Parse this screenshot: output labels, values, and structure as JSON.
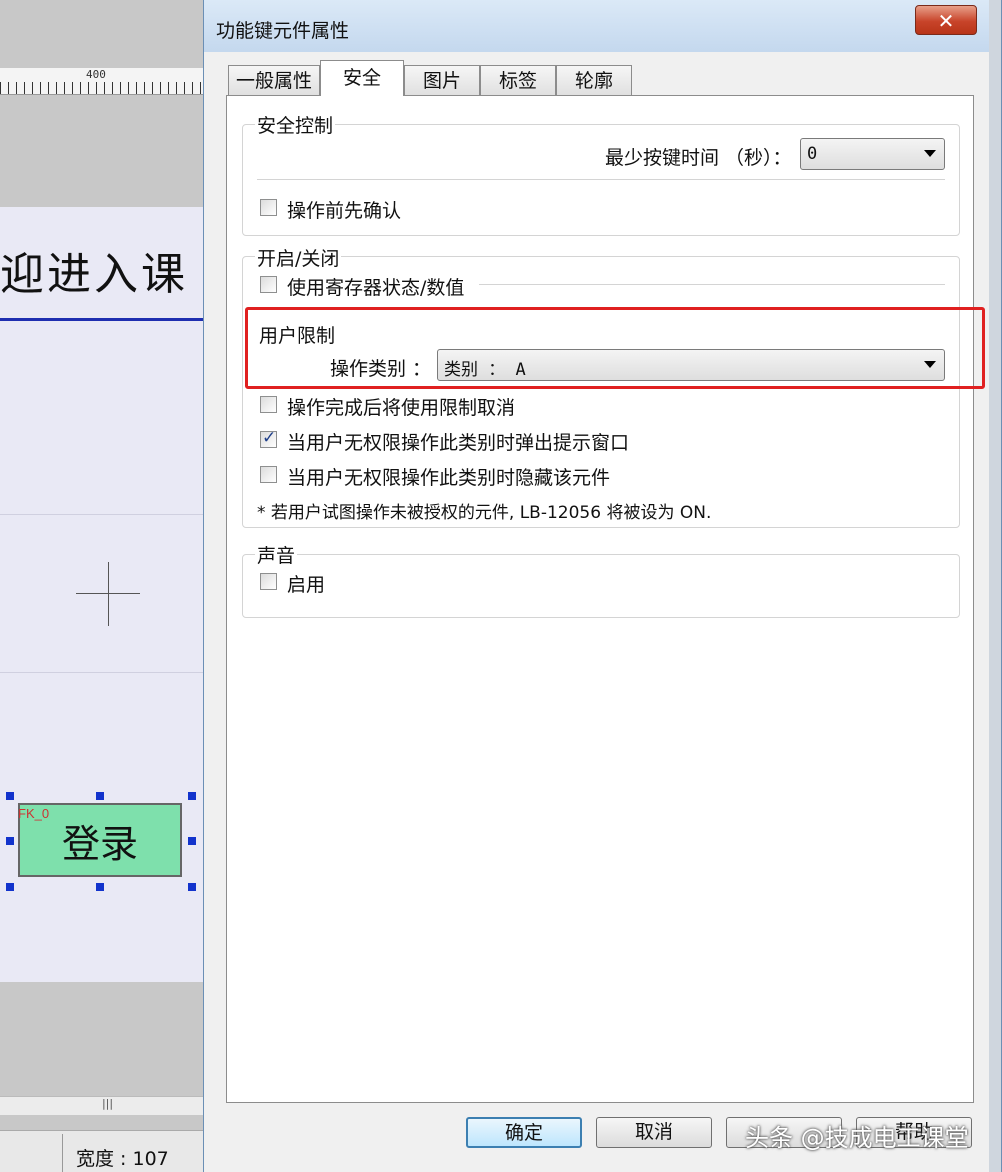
{
  "editor": {
    "ruler_number": "400",
    "welcome_text": "迎进入课",
    "button_label": "登录",
    "button_tag": "FK_0",
    "status_width": "宽度 : 107"
  },
  "dialog": {
    "title": "功能键元件属性",
    "close_label": "✕",
    "tabs": [
      {
        "label": "一般属性"
      },
      {
        "label": "安全"
      },
      {
        "label": "图片"
      },
      {
        "label": "标签"
      },
      {
        "label": "轮廓"
      }
    ],
    "security_control": {
      "legend": "安全控制",
      "min_press_label": "最少按键时间 （秒）：",
      "min_press_value": "0",
      "confirm_label": "操作前先确认"
    },
    "on_off": {
      "legend": "开启/关闭",
      "register_label": "使用寄存器状态/数值"
    },
    "user_restriction": {
      "legend": "用户限制",
      "category_label": "操作类别 ：",
      "category_value": "类别 ： A",
      "cancel_after_label": "操作完成后将使用限制取消",
      "popup_label": "当用户无权限操作此类别时弹出提示窗口",
      "popup_checked": true,
      "hide_label": "当用户无权限操作此类别时隐藏该元件",
      "note": "* 若用户试图操作未被授权的元件, LB-12056 将被设为 ON."
    },
    "sound": {
      "legend": "声音",
      "enable_label": "启用"
    },
    "buttons": {
      "ok": "确定",
      "cancel": "取消",
      "help": "帮助"
    },
    "watermark": "头条 @技成电工课堂"
  },
  "colors": {
    "highlight": "#e02020",
    "login_button": "#7ee0ac",
    "close_button": "#c8442a"
  }
}
